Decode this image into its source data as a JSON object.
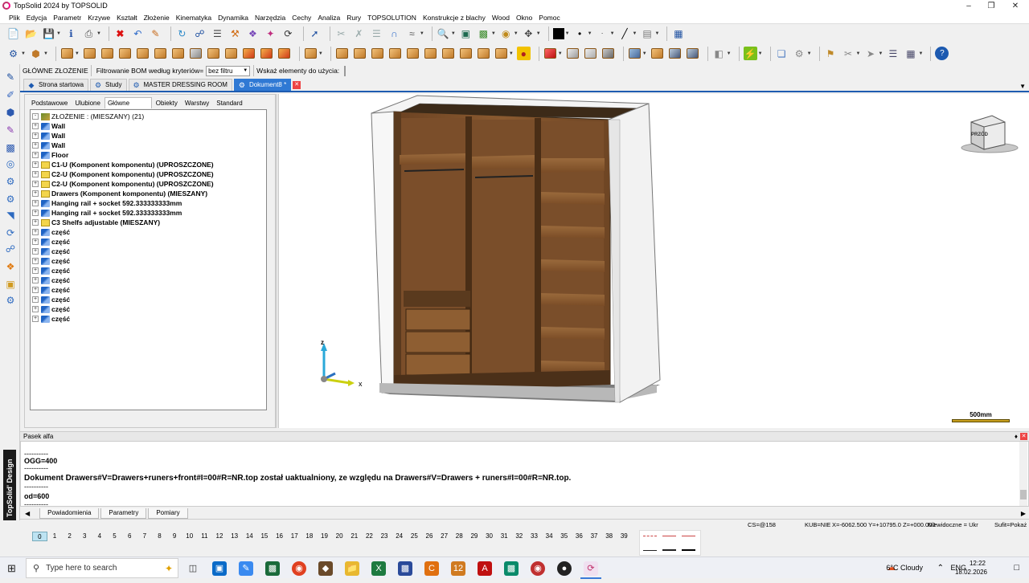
{
  "window": {
    "title": "TopSolid 2024 by TOPSOLID"
  },
  "menu": [
    "Plik",
    "Edycja",
    "Parametr",
    "Krzywe",
    "Kształt",
    "Złożenie",
    "Kinematyka",
    "Dynamika",
    "Narzędzia",
    "Cechy",
    "Analiza",
    "Rury",
    "TOPSOLUTION",
    "Konstrukcje z blachy",
    "Wood",
    "Okno",
    "Pomoc"
  ],
  "filter_bar": {
    "assembly_label": "GŁÓWNE ZŁOŻENIE",
    "filter_label": "Filtrowanie BOM według kryteriów=",
    "filter_value": "bez filtru",
    "usage_label": "Wskaż elementy do użycia:"
  },
  "doc_tabs": [
    {
      "label": "Strona startowa"
    },
    {
      "label": "Study"
    },
    {
      "label": "MASTER DRESSING ROOM"
    },
    {
      "label": "Dokument8 *",
      "active": true
    }
  ],
  "panel_tabs": [
    "Podstawowe",
    "Ulubione",
    "Główne złożenie",
    "Obiekty",
    "Warstwy",
    "Standard components"
  ],
  "panel_active_tab": "Główne złożenie",
  "tree": {
    "root": "ZŁOŻENIE : (MIESZANY) (21)",
    "items": [
      {
        "label": "Wall",
        "icon": "part"
      },
      {
        "label": "Wall",
        "icon": "part"
      },
      {
        "label": "Wall",
        "icon": "part"
      },
      {
        "label": "Floor",
        "icon": "part"
      },
      {
        "label": "C1-U (Komponent komponentu) (UPROSZCZONE)",
        "icon": "folder"
      },
      {
        "label": "C2-U (Komponent komponentu) (UPROSZCZONE)",
        "icon": "folder"
      },
      {
        "label": "C2-U (Komponent komponentu) (UPROSZCZONE)",
        "icon": "folder"
      },
      {
        "label": "Drawers (Komponent komponentu) (MIESZANY)",
        "icon": "folder"
      },
      {
        "label": "Hanging rail + socket 592.333333333mm",
        "icon": "part"
      },
      {
        "label": "Hanging rail + socket 592.333333333mm",
        "icon": "part"
      },
      {
        "label": "C3 Shelfs adjustable (MIESZANY)",
        "icon": "folder"
      },
      {
        "label": "część",
        "icon": "part"
      },
      {
        "label": "część",
        "icon": "part"
      },
      {
        "label": "część",
        "icon": "part"
      },
      {
        "label": "część",
        "icon": "part"
      },
      {
        "label": "część",
        "icon": "part"
      },
      {
        "label": "część",
        "icon": "part"
      },
      {
        "label": "część",
        "icon": "part"
      },
      {
        "label": "część",
        "icon": "part"
      },
      {
        "label": "część",
        "icon": "part"
      },
      {
        "label": "część",
        "icon": "part"
      }
    ]
  },
  "viewport": {
    "scale_label": "500mm",
    "viewcube_label": "PRZÓD",
    "axis_z": "z",
    "axis_x": "x"
  },
  "output_panel": {
    "title": "Pasek alfa",
    "lines": [
      "----------",
      "OGG=400",
      "----------",
      "Dokument Drawers#V=Drawers+runers+front#I=00#R=NR.top został uaktualniony, ze względu na Drawers#V=Drawers + runers#I=00#R=NR.top.",
      "----------",
      "od=600",
      "----------"
    ],
    "tabs": [
      "Powiadomienia",
      "Parametry",
      "Pomiary"
    ]
  },
  "brand_vertical": "TopSolid' Design",
  "status": {
    "cs": "CS=@158",
    "kub": "KUB=NIE",
    "coords": "X=-6062.500 Y=+10795.0 Z=+000.000",
    "visibility": "Niewidoczne = Ukr",
    "suffix": "Sufit=Pokaż"
  },
  "layers": [
    "0",
    "1",
    "2",
    "3",
    "4",
    "5",
    "6",
    "7",
    "8",
    "9",
    "10",
    "11",
    "12",
    "13",
    "14",
    "15",
    "16",
    "17",
    "18",
    "19",
    "20",
    "21",
    "22",
    "23",
    "24",
    "25",
    "26",
    "27",
    "28",
    "29",
    "30",
    "31",
    "32",
    "33",
    "34",
    "35",
    "36",
    "37",
    "38",
    "39"
  ],
  "taskbar": {
    "search_placeholder": "Type here to search",
    "weather": "6°C Cloudy",
    "lang": "ENG",
    "time": "12:22",
    "date": "18.02.2026"
  },
  "colors": {
    "accent": "#2f79d4",
    "wood": "#8a5a30",
    "tab_close": "#e44444"
  }
}
